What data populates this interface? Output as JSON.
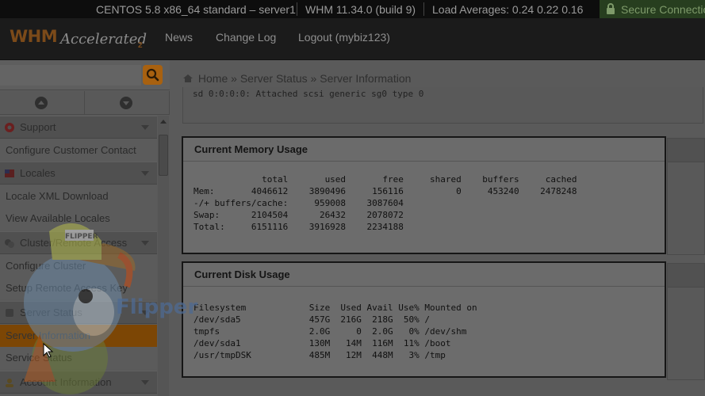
{
  "topbar": {
    "server": "CENTOS 5.8 x86_64 standard – server1",
    "version": "WHM 11.34.0 (build 9)",
    "load": "Load Averages: 0.24 0.22 0.16",
    "secure": "Secure Connection"
  },
  "header": {
    "logo_whm": "WHM",
    "logo_accelerated": "Accelerated",
    "logo_2": "2",
    "nav": [
      "News",
      "Change Log",
      "Logout (mybiz123)"
    ]
  },
  "sidebar": {
    "search_placeholder": "",
    "groups": {
      "support": "Support",
      "configure_contact": "Configure Customer Contact",
      "locales": "Locales",
      "locale_xml": "Locale XML Download",
      "view_locales": "View Available Locales",
      "cluster": "Cluster/Remote Access",
      "configure_cluster": "Configure Cluster",
      "remote_key": "Setup Remote Access Key",
      "server_status": "Server Status",
      "server_info": "Server Information",
      "service_status": "Service Status",
      "account_info": "Account Information"
    }
  },
  "breadcrumb": {
    "home": "Home",
    "sep": "»",
    "server_status": "Server Status",
    "current": "Server Information"
  },
  "top_text": "sd 0:0:0:0: Attached scsi generic sg0 type 0",
  "memory": {
    "title": "Current Memory Usage",
    "output": "             total       used       free     shared    buffers     cached\nMem:       4046612    3890496     156116          0     453240    2478248\n-/+ buffers/cache:     959008    3087604\nSwap:      2104504      26432    2078072\nTotal:     6151116    3916928    2234188"
  },
  "disk": {
    "title": "Current Disk Usage",
    "output": "Filesystem            Size  Used Avail Use% Mounted on\n/dev/sda5             457G  216G  218G  50% /\ntmpfs                 2.0G     0  2.0G   0% /dev/shm\n/dev/sda1             130M   14M  116M  11% /boot\n/usr/tmpDSK           485M   12M  448M   3% /tmp"
  },
  "watermark": {
    "text": "Flipper",
    "cap_text": "FLIPPER"
  },
  "colors": {
    "accent": "#7c4605",
    "secure": "#273e1f"
  }
}
